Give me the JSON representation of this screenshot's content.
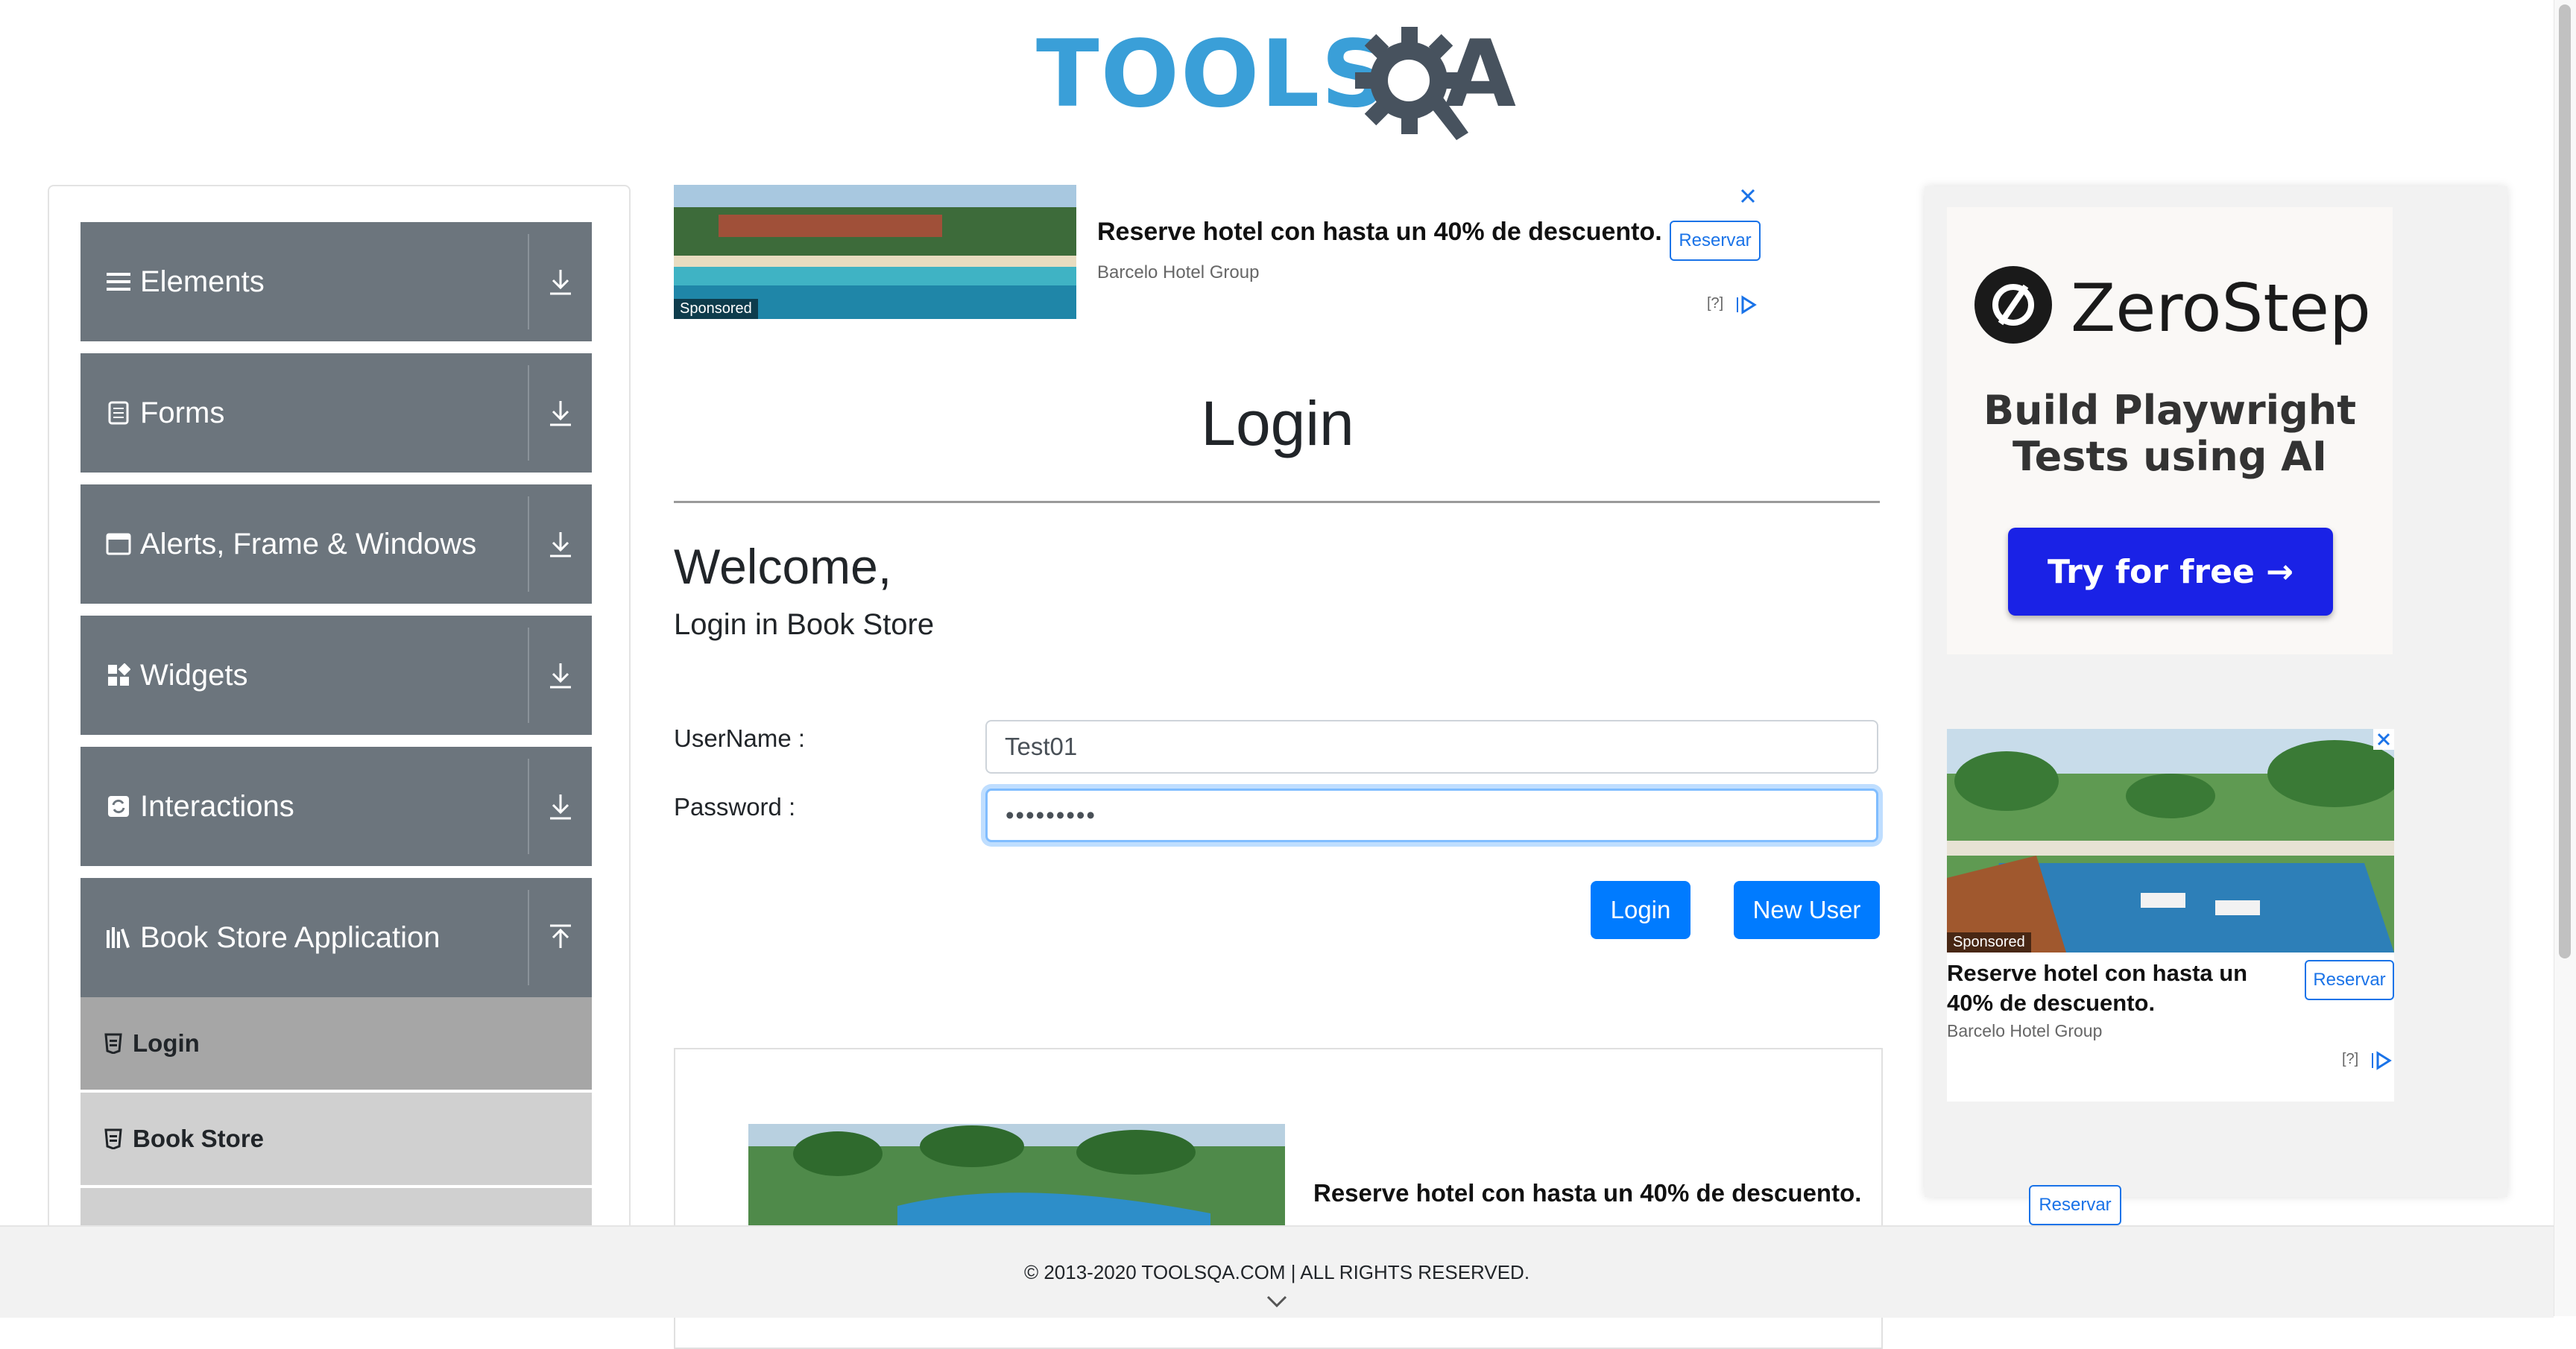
{
  "header": {
    "logo_main": "TOOLS",
    "logo_end": "A"
  },
  "sidebar": {
    "groups": [
      {
        "label": "Elements",
        "icon": "hamburger-icon"
      },
      {
        "label": "Forms",
        "icon": "document-icon"
      },
      {
        "label": "Alerts, Frame & Windows",
        "icon": "window-icon"
      },
      {
        "label": "Widgets",
        "icon": "widgets-icon"
      },
      {
        "label": "Interactions",
        "icon": "interactions-icon"
      },
      {
        "label": "Book Store Application",
        "icon": "books-icon"
      }
    ],
    "sub_items": [
      {
        "label": "Login",
        "active": true
      },
      {
        "label": "Book Store",
        "active": false
      }
    ]
  },
  "ad_top": {
    "title": "Reserve hotel con hasta un 40% de descuento.",
    "advertiser": "Barcelo Hotel Group",
    "cta": "Reservar",
    "sponsored": "Sponsored",
    "info": "[?]"
  },
  "main": {
    "title": "Login",
    "welcome": "Welcome,",
    "subtitle": "Login in Book Store",
    "username_label": "UserName :",
    "username_value": "Test01",
    "password_label": "Password :",
    "password_value": "•••••••••",
    "login_button": "Login",
    "new_user_button": "New User"
  },
  "ad_bottom": {
    "title": "Reserve hotel con hasta un 40% de descuento.",
    "cta": "Reservar"
  },
  "right_ad": {
    "brand": "ZeroStep",
    "headline_line1": "Build Playwright",
    "headline_line2": "Tests using AI",
    "cta": "Try for free →",
    "hotel_title": "Reserve hotel con hasta un 40% de descuento.",
    "hotel_advertiser": "Barcelo Hotel Group",
    "hotel_cta": "Reservar",
    "sponsored": "Sponsored",
    "info": "[?]"
  },
  "footer": {
    "copyright": "© 2013-2020 TOOLSQA.COM | ALL RIGHTS RESERVED."
  },
  "colors": {
    "sidebar_group": "#6c757d",
    "primary": "#007bff",
    "logo_blue": "#3a9fd8",
    "zerostep_blue": "#1a22e6"
  }
}
